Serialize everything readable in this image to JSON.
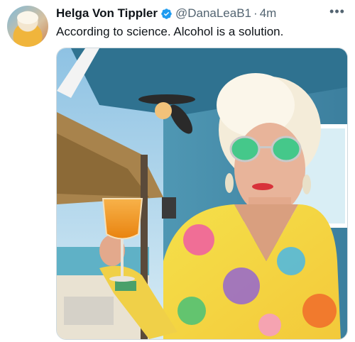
{
  "tweet": {
    "display_name": "Helga Von Tippler",
    "handle": "@DanaLeaB1",
    "separator": "·",
    "time": "4m",
    "text": "According to science. Alcohol is a solution.",
    "more_label": "•••",
    "verified_color": "#1d9bf0"
  },
  "icons": {
    "verified": "verified-badge-icon",
    "more": "more-options-icon"
  }
}
